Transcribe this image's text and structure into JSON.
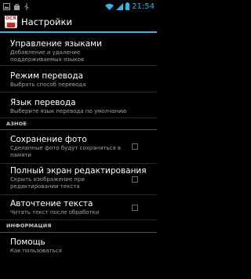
{
  "status_bar": {
    "time": "21:54",
    "time_color": "#33b5e5",
    "icons": [
      "image-icon",
      "bag-icon",
      "usb-icon",
      "wifi-icon",
      "signal-icon",
      "battery-icon"
    ]
  },
  "action_bar": {
    "app_icon_text": "OCR",
    "title": "Настройки",
    "accent_color": "#33b5e5"
  },
  "preferences": {
    "lang_management": {
      "title": "Управление языками",
      "summary": "Добавление и удаление поддерживаемых языков"
    },
    "translate_mode": {
      "title": "Режим перевода",
      "summary": "Выбрать способ перевода"
    },
    "translate_lang": {
      "title": "Язык перевода",
      "summary": "Выберите язык перевода по умолчанию"
    },
    "category_other": "АЗНОЕ",
    "save_photo": {
      "title": "Сохранение фото",
      "summary": "Сделанные фото будут сохраняться в памяти"
    },
    "fullscreen_edit": {
      "title": "Полный экран редактирования",
      "summary": "Скрыть изображение при редактировании текста"
    },
    "autoread": {
      "title": "Авточтение текста",
      "summary": "Читать текст после обработки"
    },
    "category_info": "ИНФОРМАЦИЯ",
    "help": {
      "title": "Помощь",
      "summary": "Как пользоваться"
    }
  }
}
